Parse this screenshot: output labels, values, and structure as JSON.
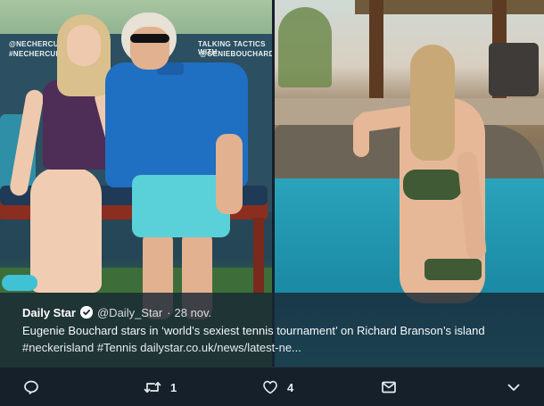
{
  "media": {
    "left_photo_banner": {
      "left_tags": [
        "@NECHERCUP",
        "#NECHERCUP"
      ],
      "right_tags": [
        "TALKING TACTICS WITH",
        "@GENIEBOUCHARD"
      ]
    }
  },
  "tweet": {
    "author_name": "Daily Star",
    "handle": "@Daily_Star",
    "separator": "·",
    "date": "28 nov.",
    "text": "Eugenie Bouchard stars in ‘world’s sexiest tennis tournament’ on Richard Branson’s island",
    "hashtags_line": "#neckerisland #Tennis dailystar.co.uk/news/latest-ne..."
  },
  "actions": {
    "reply": {
      "icon": "reply-icon",
      "count": ""
    },
    "retweet": {
      "icon": "retweet-icon",
      "count": "1"
    },
    "like": {
      "icon": "heart-icon",
      "count": "4"
    },
    "message": {
      "icon": "envelope-icon",
      "count": ""
    },
    "more": {
      "icon": "chevron-down-icon",
      "count": ""
    }
  },
  "colors": {
    "background": "#15202b",
    "overlay": "#192734",
    "text": "#e6ecf0"
  }
}
